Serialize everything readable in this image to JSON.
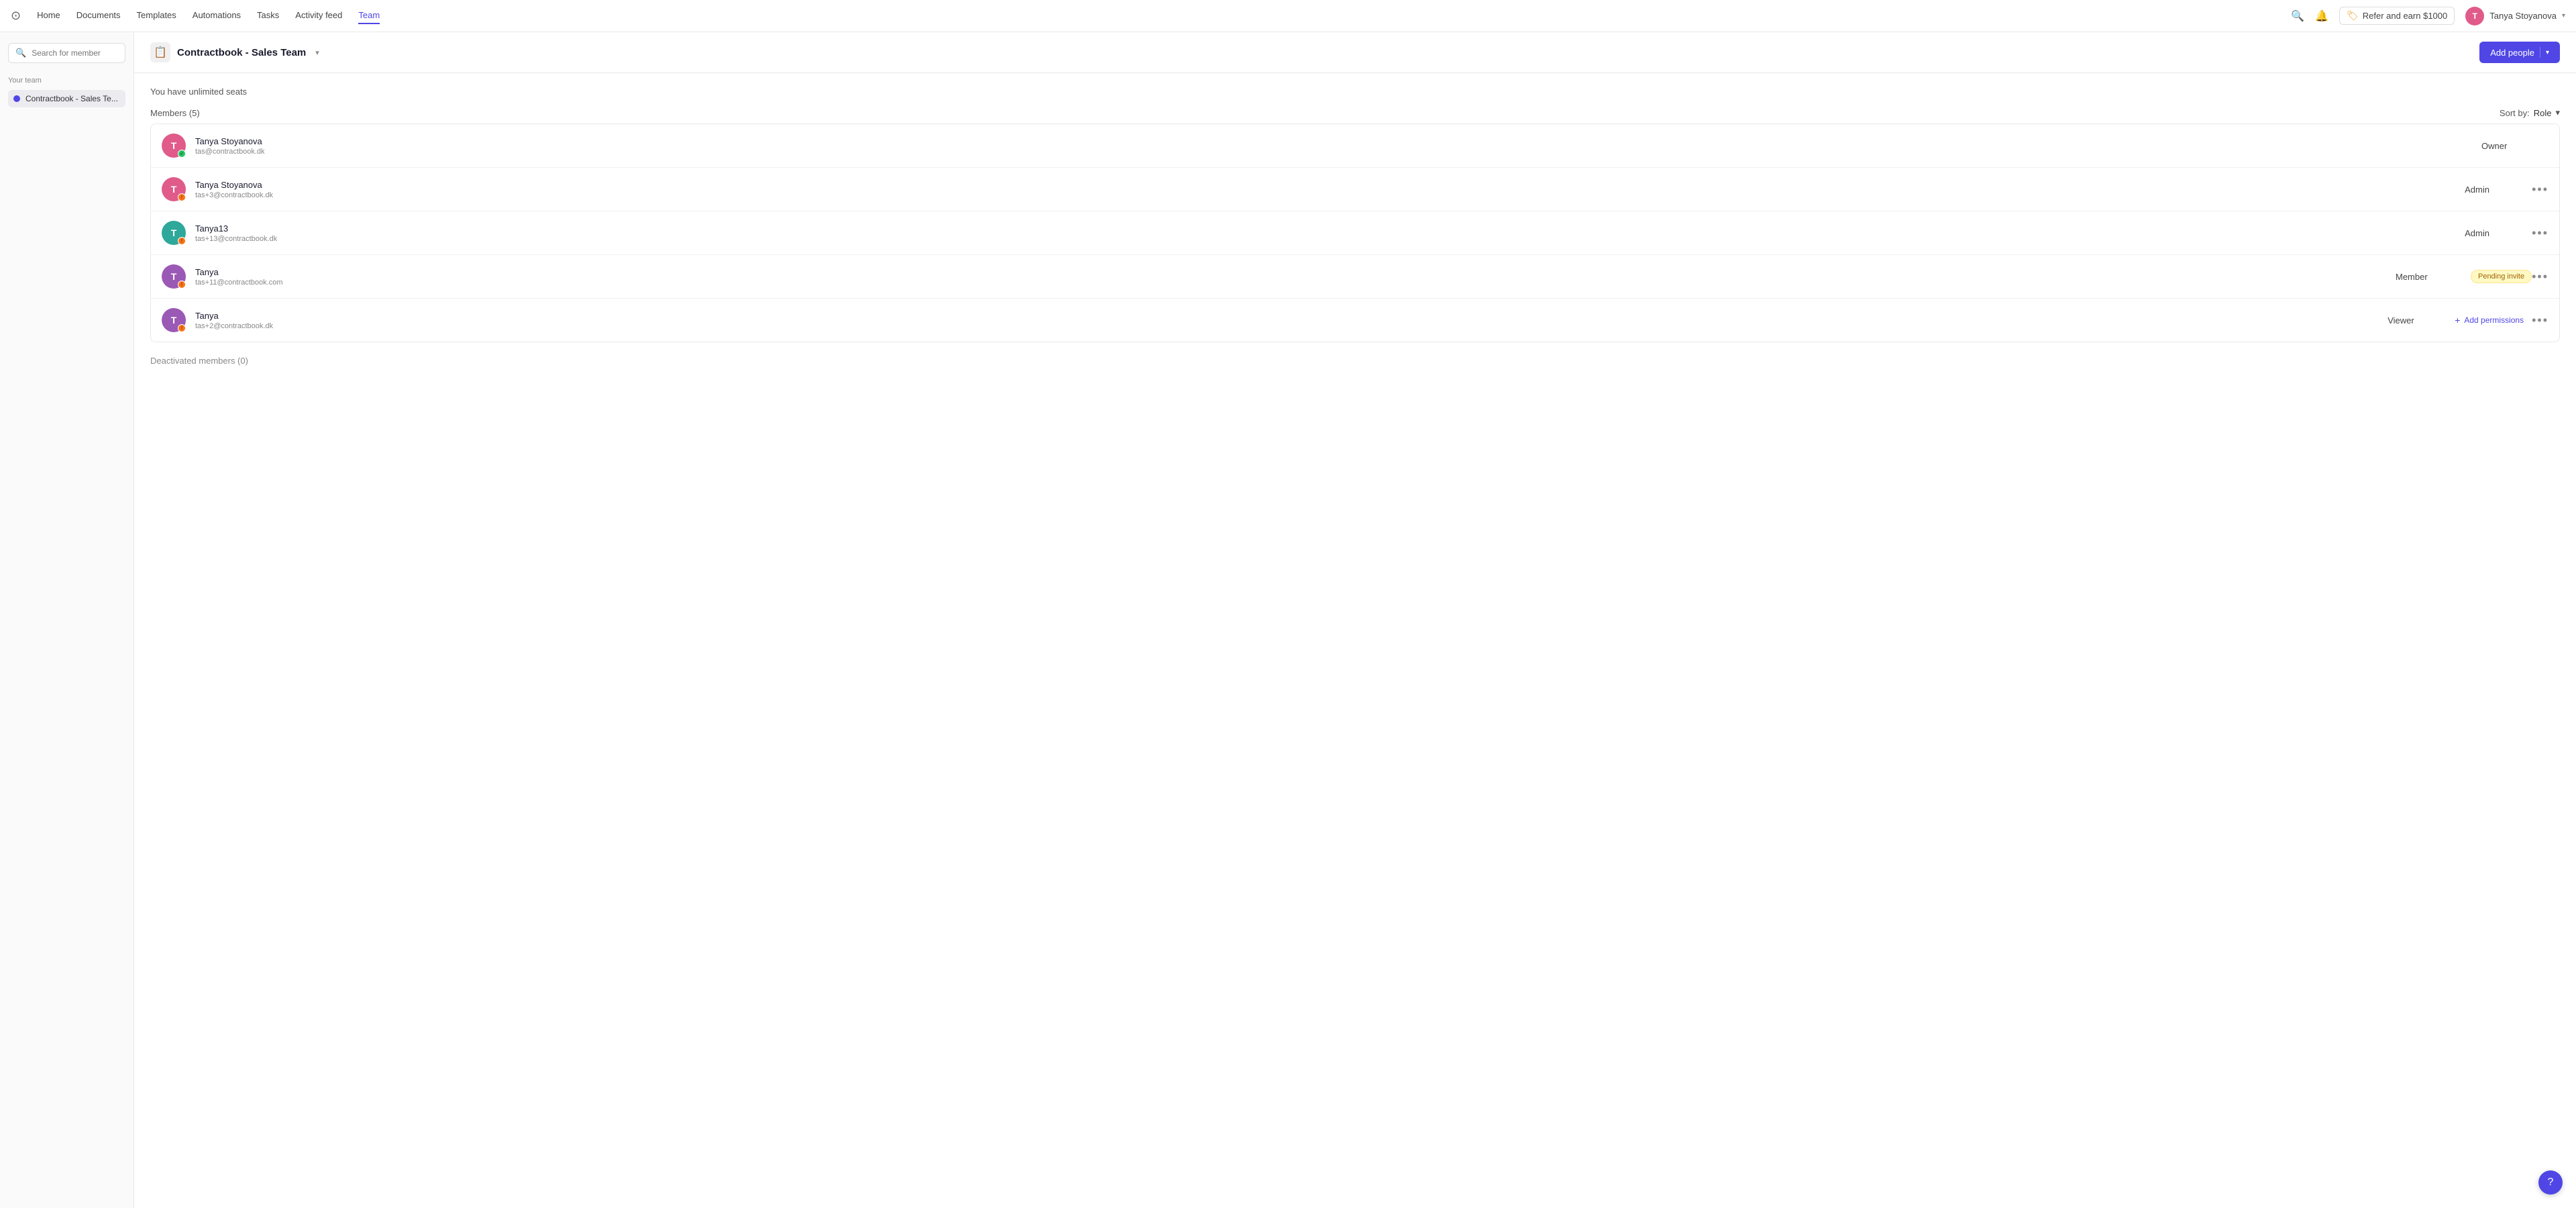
{
  "nav": {
    "links": [
      {
        "label": "Home",
        "active": false
      },
      {
        "label": "Documents",
        "active": false
      },
      {
        "label": "Templates",
        "active": false
      },
      {
        "label": "Automations",
        "active": false
      },
      {
        "label": "Tasks",
        "active": false
      },
      {
        "label": "Activity feed",
        "active": false
      },
      {
        "label": "Team",
        "active": true
      }
    ],
    "refer_label": "Refer and earn $1000",
    "user_name": "Tanya Stoyanova",
    "user_initial": "T"
  },
  "sidebar": {
    "search_placeholder": "Search for member",
    "your_team_label": "Your team",
    "team_item_label": "Contractbook - Sales Te..."
  },
  "main": {
    "title": "Contractbook - Sales Team",
    "unlimited_seats": "You have unlimited seats",
    "members_count": "Members (5)",
    "sort_by_label": "Sort by:",
    "sort_by_value": "Role",
    "add_people_label": "Add people",
    "deactivated_label": "Deactivated members (0)",
    "members": [
      {
        "id": 1,
        "name": "Tanya Stoyanova",
        "email": "tas@contractbook.dk",
        "role": "Owner",
        "avatar_color": "pink",
        "initial": "T",
        "status": "green",
        "pending": false,
        "show_add_perm": false,
        "show_more": false
      },
      {
        "id": 2,
        "name": "Tanya Stoyanova",
        "email": "tas+3@contractbook.dk",
        "role": "Admin",
        "avatar_color": "pink",
        "initial": "T",
        "status": "orange",
        "pending": false,
        "show_add_perm": false,
        "show_more": true
      },
      {
        "id": 3,
        "name": "Tanya13",
        "email": "tas+13@contractbook.dk",
        "role": "Admin",
        "avatar_color": "teal",
        "initial": "T",
        "status": "orange",
        "pending": false,
        "show_add_perm": false,
        "show_more": true
      },
      {
        "id": 4,
        "name": "Tanya",
        "email": "tas+11@contractbook.com",
        "role": "Member",
        "avatar_color": "purple",
        "initial": "T",
        "status": "orange",
        "pending": true,
        "pending_label": "Pending invite",
        "show_add_perm": false,
        "show_more": true
      },
      {
        "id": 5,
        "name": "Tanya",
        "email": "tas+2@contractbook.dk",
        "role": "Viewer",
        "avatar_color": "purple",
        "initial": "T",
        "status": "orange",
        "pending": false,
        "show_add_perm": true,
        "add_perm_label": "Add permissions",
        "show_more": true
      }
    ]
  },
  "icons": {
    "search": "🔍",
    "bell": "🔔",
    "gift": "🏷",
    "help": "?",
    "more": "•••"
  }
}
